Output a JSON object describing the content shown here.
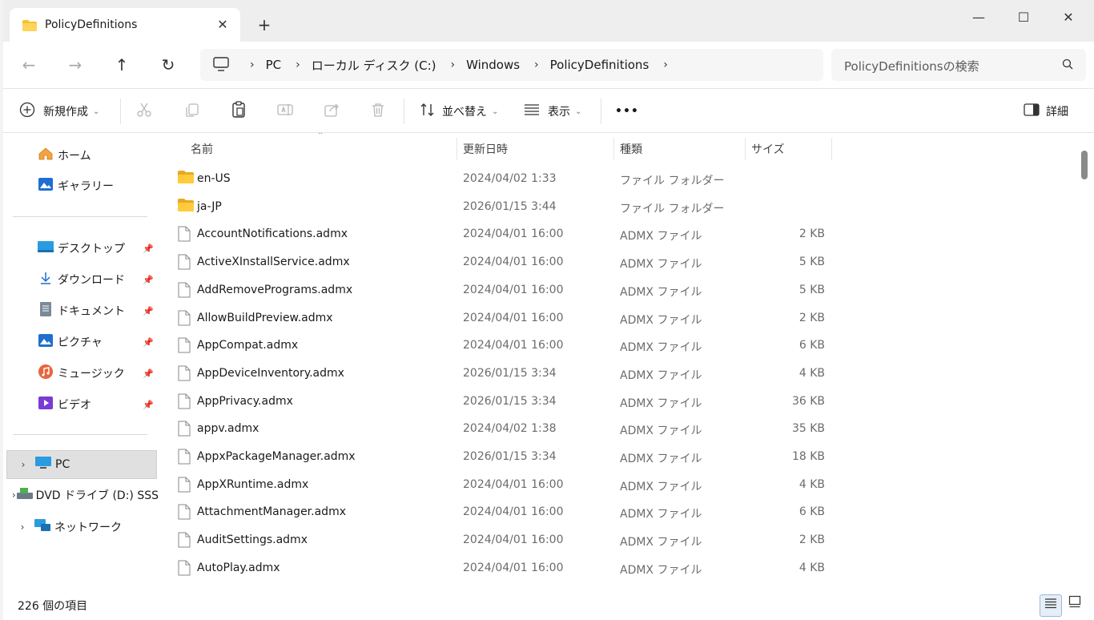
{
  "tab": {
    "title": "PolicyDefinitions",
    "close": "✕",
    "new": "+"
  },
  "window_controls": {
    "minimize": "—",
    "maximize": "☐",
    "close": "✕"
  },
  "nav": {
    "back": "←",
    "forward": "→",
    "up": "↑",
    "refresh": "↻"
  },
  "address": {
    "crumbs": [
      "PC",
      "ローカル ディスク (C:)",
      "Windows",
      "PolicyDefinitions"
    ],
    "sep": "›"
  },
  "search": {
    "placeholder": "PolicyDefinitionsの検索"
  },
  "toolbar": {
    "new_label": "新規作成",
    "sort_label": "並べ替え",
    "view_label": "表示",
    "more_label": "•••",
    "details_label": "詳細"
  },
  "sidebar": {
    "home": "ホーム",
    "gallery": "ギャラリー",
    "pinned": [
      {
        "label": "デスクトップ",
        "icon": "desktop-icon"
      },
      {
        "label": "ダウンロード",
        "icon": "download-icon"
      },
      {
        "label": "ドキュメント",
        "icon": "document-icon"
      },
      {
        "label": "ピクチャ",
        "icon": "pictures-icon"
      },
      {
        "label": "ミュージック",
        "icon": "music-icon"
      },
      {
        "label": "ビデオ",
        "icon": "video-icon"
      }
    ],
    "pc": "PC",
    "dvd": "DVD ドライブ (D:) SSS",
    "network": "ネットワーク"
  },
  "columns": {
    "name": "名前",
    "date": "更新日時",
    "type": "種類",
    "size": "サイズ"
  },
  "files": [
    {
      "name": "en-US",
      "date": "2024/04/02 1:33",
      "type": "ファイル フォルダー",
      "size": "",
      "kind": "folder"
    },
    {
      "name": "ja-JP",
      "date": "2026/01/15 3:44",
      "type": "ファイル フォルダー",
      "size": "",
      "kind": "folder"
    },
    {
      "name": "AccountNotifications.admx",
      "date": "2024/04/01 16:00",
      "type": "ADMX ファイル",
      "size": "2 KB",
      "kind": "file"
    },
    {
      "name": "ActiveXInstallService.admx",
      "date": "2024/04/01 16:00",
      "type": "ADMX ファイル",
      "size": "5 KB",
      "kind": "file"
    },
    {
      "name": "AddRemovePrograms.admx",
      "date": "2024/04/01 16:00",
      "type": "ADMX ファイル",
      "size": "5 KB",
      "kind": "file"
    },
    {
      "name": "AllowBuildPreview.admx",
      "date": "2024/04/01 16:00",
      "type": "ADMX ファイル",
      "size": "2 KB",
      "kind": "file"
    },
    {
      "name": "AppCompat.admx",
      "date": "2024/04/01 16:00",
      "type": "ADMX ファイル",
      "size": "6 KB",
      "kind": "file"
    },
    {
      "name": "AppDeviceInventory.admx",
      "date": "2026/01/15 3:34",
      "type": "ADMX ファイル",
      "size": "4 KB",
      "kind": "file"
    },
    {
      "name": "AppPrivacy.admx",
      "date": "2026/01/15 3:34",
      "type": "ADMX ファイル",
      "size": "36 KB",
      "kind": "file"
    },
    {
      "name": "appv.admx",
      "date": "2024/04/02 1:38",
      "type": "ADMX ファイル",
      "size": "35 KB",
      "kind": "file"
    },
    {
      "name": "AppxPackageManager.admx",
      "date": "2026/01/15 3:34",
      "type": "ADMX ファイル",
      "size": "18 KB",
      "kind": "file"
    },
    {
      "name": "AppXRuntime.admx",
      "date": "2024/04/01 16:00",
      "type": "ADMX ファイル",
      "size": "4 KB",
      "kind": "file"
    },
    {
      "name": "AttachmentManager.admx",
      "date": "2024/04/01 16:00",
      "type": "ADMX ファイル",
      "size": "6 KB",
      "kind": "file"
    },
    {
      "name": "AuditSettings.admx",
      "date": "2024/04/01 16:00",
      "type": "ADMX ファイル",
      "size": "2 KB",
      "kind": "file"
    },
    {
      "name": "AutoPlay.admx",
      "date": "2024/04/01 16:00",
      "type": "ADMX ファイル",
      "size": "4 KB",
      "kind": "file"
    }
  ],
  "status": {
    "count": "226 個の項目"
  },
  "colors": {
    "folder": "#f4c22b",
    "selected": "#e0e0e0",
    "accent": "#0067c0"
  }
}
